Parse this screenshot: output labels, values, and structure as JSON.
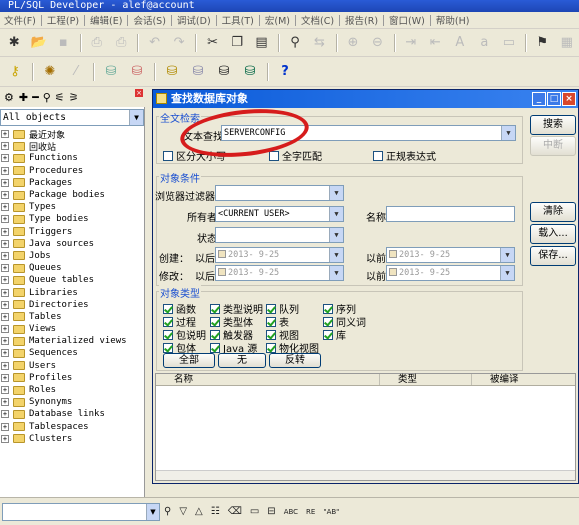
{
  "window": {
    "title": "PL/SQL Developer - alef@account"
  },
  "menu": [
    "文件(F)",
    "工程(P)",
    "编辑(E)",
    "会话(S)",
    "调试(D)",
    "工具(T)",
    "宏(M)",
    "文档(C)",
    "报告(R)",
    "窗口(W)",
    "帮助(H)"
  ],
  "toolbar1_icons": [
    "new-icon",
    "open-icon",
    "save-icon",
    "print-icon",
    "print-preview-icon",
    "undo-icon",
    "redo-icon",
    "cut-icon",
    "copy-icon",
    "paste-icon",
    "find-icon",
    "replace-icon",
    "execute-icon",
    "step-icon",
    "indent-icon",
    "unindent-icon",
    "uppercase-icon",
    "lowercase-icon",
    "comment-icon",
    "help-context-icon"
  ],
  "toolbar2_icons": [
    "key-icon",
    "connect-icon",
    "disconnect-icon",
    "commit-icon",
    "rollback-icon",
    "sql-window-icon",
    "command-window-icon",
    "explain-icon",
    "report-icon",
    "help-icon"
  ],
  "browser": {
    "filter": "All objects",
    "items": [
      "最近对象",
      "回收站",
      "Functions",
      "Procedures",
      "Packages",
      "Package bodies",
      "Types",
      "Type bodies",
      "Triggers",
      "Java sources",
      "Jobs",
      "Queues",
      "Queue tables",
      "Libraries",
      "Directories",
      "Tables",
      "Views",
      "Materialized views",
      "Sequences",
      "Users",
      "Profiles",
      "Roles",
      "Synonyms",
      "Database links",
      "Tablespaces",
      "Clusters"
    ]
  },
  "dialog": {
    "title": "查找数据库对象",
    "fulltext_group": "全文检索",
    "text_search_label": "文本查找",
    "text_search_value": "SERVERCONFIG",
    "case_label": "区分大小写",
    "whole_word_label": "全字匹配",
    "regex_label": "正规表达式",
    "conditions_group": "对象条件",
    "browser_filter_label": "浏览器过滤器",
    "owner_label": "所有者",
    "owner_value": "<CURRENT USER>",
    "name_label": "名称",
    "status_label": "状态",
    "created_label": "创建：",
    "modified_label": "修改：",
    "after_label": "以后",
    "before_label": "以前",
    "date_value": "2013- 9-25",
    "types_group": "对象类型",
    "types": [
      {
        "label": "函数",
        "checked": true
      },
      {
        "label": "类型说明",
        "checked": true
      },
      {
        "label": "队列",
        "checked": true
      },
      {
        "label": "序列",
        "checked": true
      },
      {
        "label": "过程",
        "checked": true
      },
      {
        "label": "类型体",
        "checked": true
      },
      {
        "label": "表",
        "checked": true
      },
      {
        "label": "同义词",
        "checked": true
      },
      {
        "label": "包说明",
        "checked": true
      },
      {
        "label": "触发器",
        "checked": true
      },
      {
        "label": "视图",
        "checked": true
      },
      {
        "label": "库",
        "checked": true
      },
      {
        "label": "包体",
        "checked": true
      },
      {
        "label": "Java 源",
        "checked": true
      },
      {
        "label": "物化视图",
        "checked": true
      }
    ],
    "btn_all": "全部",
    "btn_none": "无",
    "btn_invert": "反转",
    "btn_search": "搜索",
    "btn_abort": "中断",
    "btn_clear": "清除",
    "btn_load": "载入...",
    "btn_save": "保存...",
    "columns": [
      "名称",
      "类型",
      "被编译"
    ]
  },
  "colors": {
    "titlebar": "#1d46b5",
    "dialog_title": "#0a5ad8",
    "annotation": "#d61c1c",
    "group_label": "#1a4fd1"
  }
}
